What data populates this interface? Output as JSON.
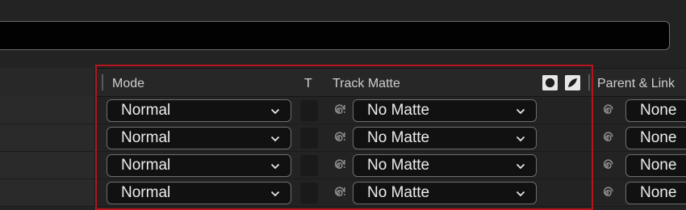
{
  "header": {
    "mode_label": "Mode",
    "t_label": "T",
    "track_matte_label": "Track Matte",
    "parent_link_label": "Parent & Link"
  },
  "rows": [
    {
      "mode": "Normal",
      "track_matte": "No Matte",
      "parent": "None"
    },
    {
      "mode": "Normal",
      "track_matte": "No Matte",
      "parent": "None"
    },
    {
      "mode": "Normal",
      "track_matte": "No Matte",
      "parent": "None"
    },
    {
      "mode": "Normal",
      "track_matte": "No Matte",
      "parent": "None"
    }
  ],
  "icons": {
    "alpha_matte": "alpha-matte-icon",
    "invert_matte": "invert-matte-icon",
    "pickwhip": "pickwhip-icon",
    "chevron": "chevron-down-icon"
  },
  "colors": {
    "background": "#232323",
    "highlight": "#b5161c",
    "field": "#111111"
  }
}
